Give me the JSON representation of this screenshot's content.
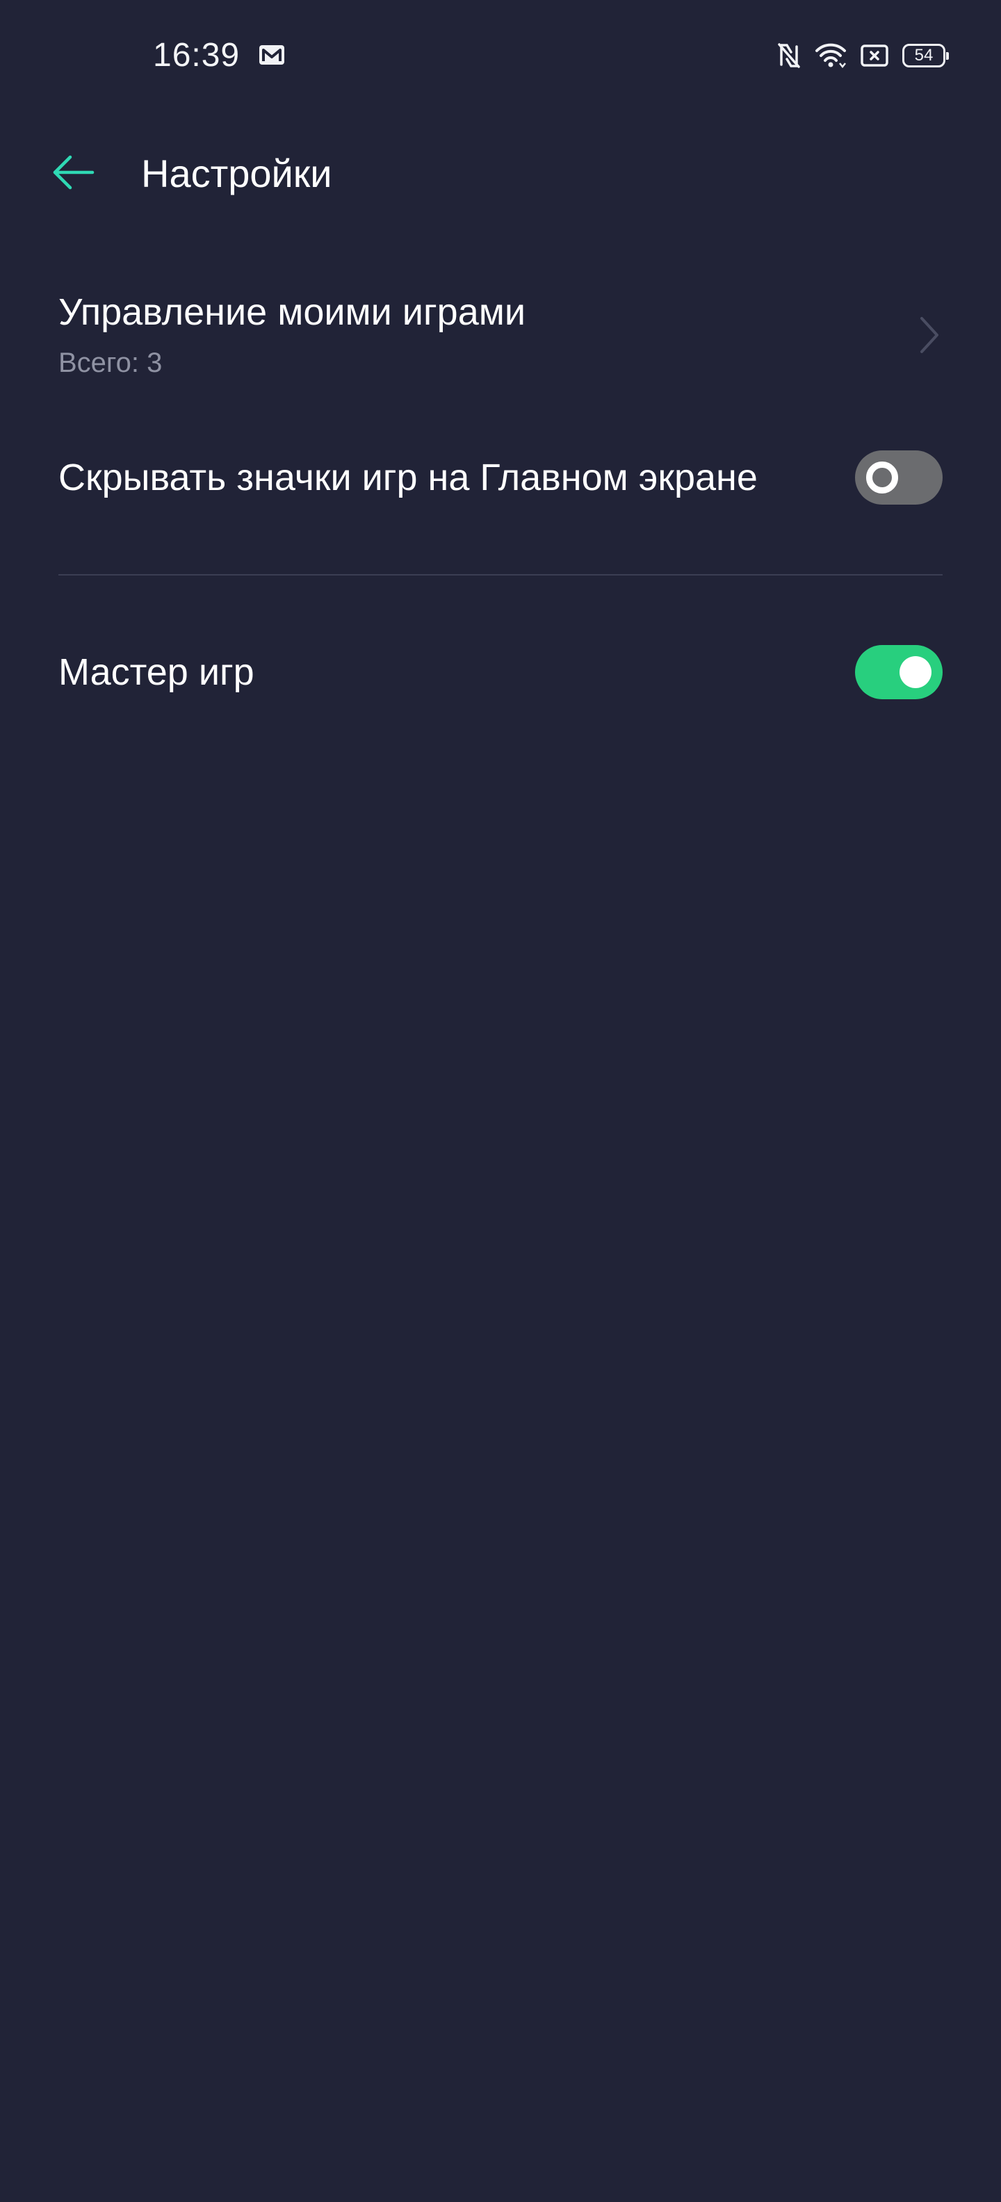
{
  "status_bar": {
    "time": "16:39",
    "battery": "54",
    "icons": [
      "mail-icon",
      "nfc-icon",
      "wifi-icon",
      "no-sim-icon",
      "battery-icon"
    ]
  },
  "header": {
    "title": "Настройки",
    "back_icon": "arrow-left-icon"
  },
  "settings": {
    "manage_games": {
      "title": "Управление моими играми",
      "subtitle": "Всего: 3",
      "icon": "chevron-right-icon"
    },
    "hide_icons": {
      "title": "Скрывать значки игр на Главном экране",
      "enabled": false
    },
    "game_master": {
      "title": "Мастер игр",
      "enabled": true
    }
  },
  "colors": {
    "background": "#212337",
    "accent": "#2fd9b4",
    "toggle_on": "#28cf7e",
    "toggle_off": "#6b6c6f",
    "subtitle": "#8f92a3",
    "divider": "#3b3e53"
  }
}
